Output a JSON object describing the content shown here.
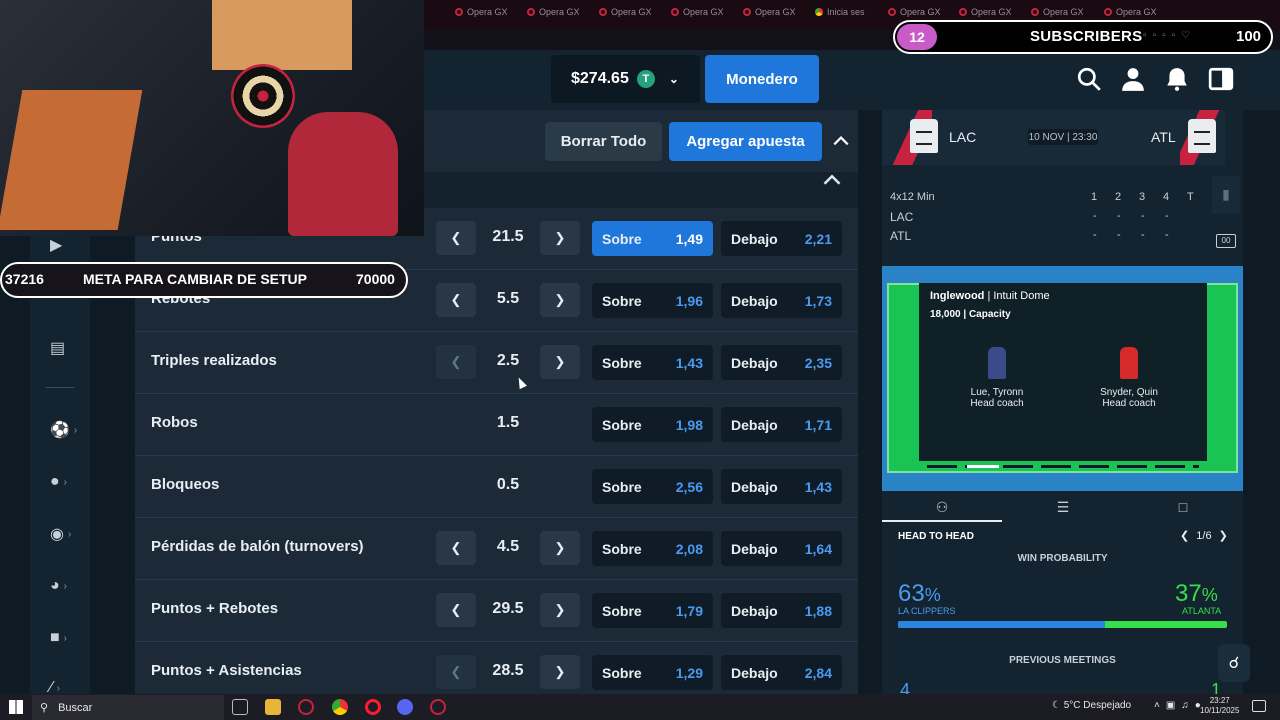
{
  "browser": {
    "tabs": [
      "Opera GX",
      "Opera GX",
      "Opera GX",
      "Opera GX",
      "Opera GX",
      "Inicia ses",
      "Opera GX",
      "Opera GX",
      "Opera GX",
      "Opera GX"
    ]
  },
  "header": {
    "balance": "$274.65",
    "wallet_label": "Monedero"
  },
  "betslip": {
    "clear_label": "Borrar Todo",
    "add_label": "Agregar apuesta"
  },
  "markets": [
    {
      "label": "Puntos",
      "line": "21.5",
      "stepper": true,
      "over_label": "Sobre",
      "over_odds": "1,49",
      "under_label": "Debajo",
      "under_odds": "2,21",
      "selected": "over"
    },
    {
      "label": "Rebotes",
      "line": "5.5",
      "stepper": true,
      "over_label": "Sobre",
      "over_odds": "1,96",
      "under_label": "Debajo",
      "under_odds": "1,73"
    },
    {
      "label": "Triples realizados",
      "line": "2.5",
      "stepper": true,
      "prev_disabled": true,
      "over_label": "Sobre",
      "over_odds": "1,43",
      "under_label": "Debajo",
      "under_odds": "2,35"
    },
    {
      "label": "Robos",
      "line": "1.5",
      "stepper": false,
      "over_label": "Sobre",
      "over_odds": "1,98",
      "under_label": "Debajo",
      "under_odds": "1,71"
    },
    {
      "label": "Bloqueos",
      "line": "0.5",
      "stepper": false,
      "over_label": "Sobre",
      "over_odds": "2,56",
      "under_label": "Debajo",
      "under_odds": "1,43"
    },
    {
      "label": "Pérdidas de balón (turnovers)",
      "line": "4.5",
      "stepper": true,
      "over_label": "Sobre",
      "over_odds": "2,08",
      "under_label": "Debajo",
      "under_odds": "1,64"
    },
    {
      "label": "Puntos + Rebotes",
      "line": "29.5",
      "stepper": true,
      "over_label": "Sobre",
      "over_odds": "1,79",
      "under_label": "Debajo",
      "under_odds": "1,88"
    },
    {
      "label": "Puntos + Asistencias",
      "line": "28.5",
      "stepper": true,
      "prev_disabled": true,
      "over_label": "Sobre",
      "over_odds": "1,29",
      "under_label": "Debajo",
      "under_odds": "2,84"
    }
  ],
  "match": {
    "home": "LAC",
    "away": "ATL",
    "datetime": "10 NOV | 23:30",
    "period_label": "4x12 Min",
    "periods": [
      "1",
      "2",
      "3",
      "4",
      "T"
    ],
    "home_scores": [
      "-",
      "-",
      "-",
      "-"
    ],
    "away_scores": [
      "-",
      "-",
      "-",
      "-"
    ]
  },
  "venue": {
    "name": "Inglewood",
    "arena": "| Intuit Dome",
    "capacity": "18,000 | Capacity",
    "coaches": [
      {
        "name": "Lue, Tyronn",
        "role": "Head coach",
        "color": "#3a4a8a"
      },
      {
        "name": "Snyder, Quin",
        "role": "Head coach",
        "color": "#d62a2a"
      }
    ]
  },
  "h2h": {
    "title": "HEAD TO HEAD",
    "pager": "1/6",
    "win_prob_title": "WIN PROBABILITY",
    "home_pct": "63",
    "away_pct": "37",
    "pct_sign": "%",
    "home_name": "LA CLIPPERS",
    "away_name": "ATLANTA",
    "home_share": 0.63,
    "previous_title": "PREVIOUS MEETINGS",
    "prev_home": "4",
    "prev_away": "1"
  },
  "overlay": {
    "sub_count": "12",
    "subscribers_label": "SUBSCRIBERS",
    "sub_goal": "100",
    "goal_current": "37216",
    "goal_label": "META PARA CAMBIAR DE SETUP",
    "goal_target": "70000"
  },
  "taskbar": {
    "search_placeholder": "Buscar",
    "weather": "5°C  Despejado",
    "time": "23:27",
    "date": "10/11/2025"
  },
  "colors": {
    "accent": "#1f76db",
    "odds": "#4a9bf0",
    "away_green": "#35e04a",
    "brand_red": "#c7223f"
  }
}
